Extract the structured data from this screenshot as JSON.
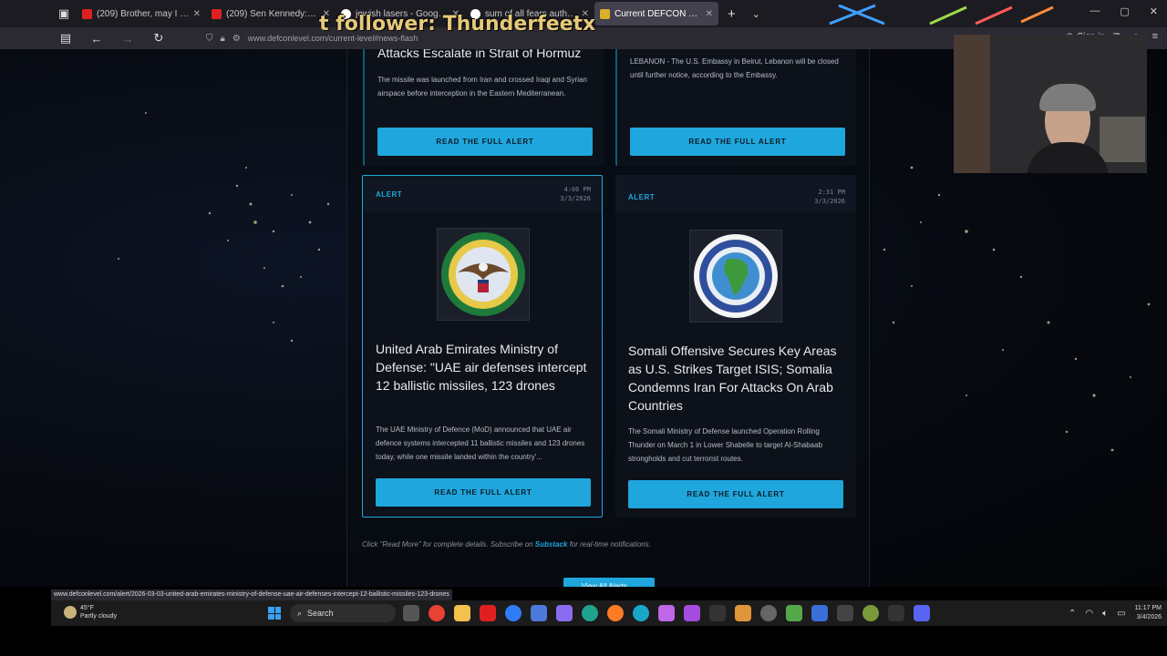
{
  "browser": {
    "tabs": [
      {
        "title": "(209) Brother, may I look in your",
        "fav": "#e02020"
      },
      {
        "title": "(209) Sen Kennedy: May he RE",
        "fav": "#e02020"
      },
      {
        "title": "jewish lasers - Google Search",
        "fav": "#ffffff"
      },
      {
        "title": "sum of all fears author - Google",
        "fav": "#ffffff"
      },
      {
        "title": "Current DEFCON Level 2026 | T",
        "fav": "#d9b02a",
        "active": true
      }
    ],
    "new_tab_symbol": "+",
    "url": "www.defconlevel.com/current-level#news-flash",
    "sign_in": "Sign in",
    "status_url": "www.defconlevel.com/alert/2026-03-03-united-arab-emirates-ministry-of-defense-uae-air-defenses-intercept-12-ballistic-missiles-123-drones"
  },
  "overlay": {
    "text": "t follower: Thunderfeetx"
  },
  "cards": {
    "top_left": {
      "headline": "Attacks Escalate in Strait of Hormuz",
      "summary": "The missile was launched from Iran and crossed Iraqi and Syrian airspace before interception in the Eastern Mediterranean.",
      "button": "READ THE FULL ALERT"
    },
    "top_right": {
      "summary": "LEBANON - The U.S. Embassy in Beirut, Lebanon will be closed until further notice, according to the Embassy.",
      "button": "READ THE FULL ALERT"
    },
    "bottom_left": {
      "tag": "ALERT",
      "time": "4:06 PM",
      "date": "3/3/2026",
      "headline": "United Arab Emirates Ministry of Defense: \"UAE air defenses intercept 12 ballistic missiles, 123 drones",
      "summary": "The UAE Ministry of Defence (MoD) announced that UAE air defence systems intercepted 11 ballistic missiles and 123 drones today, while one missile landed within the country'...",
      "button": "READ THE FULL ALERT",
      "seal_text": "UNITED STATES CENTRAL COMMAND",
      "seal_icon": "centcom-seal-icon"
    },
    "bottom_right": {
      "tag": "ALERT",
      "time": "2:31 PM",
      "date": "3/3/2026",
      "headline": "Somali Offensive Secures Key Areas as U.S. Strikes Target ISIS; Somalia Condemns Iran For Attacks On Arab Countries",
      "summary": "The Somali Ministry of Defense launched Operation Rolling Thunder on March 1 in Lower Shabelle to target Al-Shabaab strongholds and cut terrorist routes.",
      "button": "READ THE FULL ALERT",
      "seal_text": "UNITED STATES AFRICA COMMAND",
      "seal_icon": "africom-seal-icon"
    }
  },
  "footer": {
    "note_before": "Click \"Read More\" for complete details. Subscribe on ",
    "note_link": "Substack",
    "note_after": " for real-time notifications.",
    "view_all": "View All Alerts →"
  },
  "taskbar": {
    "temp": "45°F",
    "weather": "Partly cloudy",
    "search": "Search",
    "time": "11:17 PM",
    "date": "3/4/2026"
  },
  "colors": {
    "accent": "#1fa6dc",
    "card_bg": "#0d1119",
    "page_bg": "#06090f"
  }
}
